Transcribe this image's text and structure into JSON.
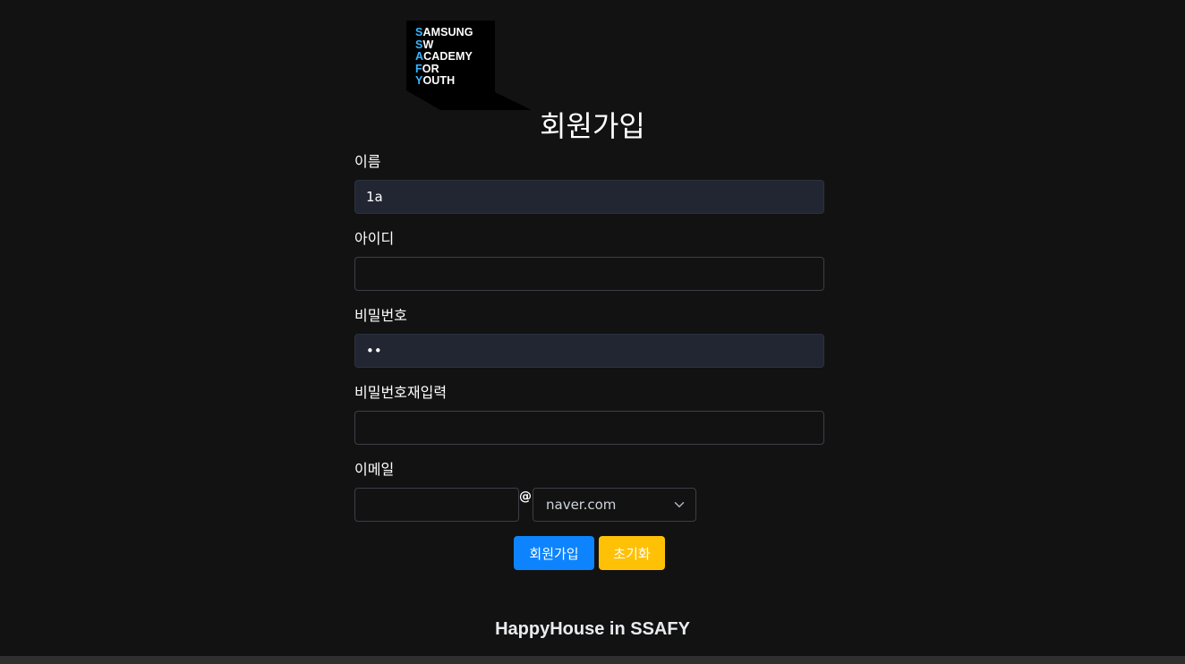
{
  "logo": {
    "lines": [
      {
        "first": "S",
        "rest": "AMSUNG"
      },
      {
        "first": "S",
        "rest": "W"
      },
      {
        "first": "A",
        "rest": "CADEMY"
      },
      {
        "first": "F",
        "rest": "OR"
      },
      {
        "first": "Y",
        "rest": "OUTH"
      }
    ],
    "bg_color": "#000000",
    "accent_color": "#38b6ff"
  },
  "form": {
    "title": "회원가입",
    "name": {
      "label": "이름",
      "value": "1a"
    },
    "user_id": {
      "label": "아이디",
      "value": ""
    },
    "password": {
      "label": "비밀번호",
      "value": "12"
    },
    "password_confirm": {
      "label": "비밀번호재입력",
      "value": ""
    },
    "email": {
      "label": "이메일",
      "local_value": "",
      "at": "@",
      "domain_selected": "naver.com"
    },
    "buttons": {
      "submit": "회원가입",
      "reset": "초기화"
    }
  },
  "footer": {
    "text": "HappyHouse in SSAFY"
  },
  "colors": {
    "background": "#121212",
    "primary": "#0d84fd",
    "warning": "#ffc106",
    "filled_input": "#212632"
  }
}
